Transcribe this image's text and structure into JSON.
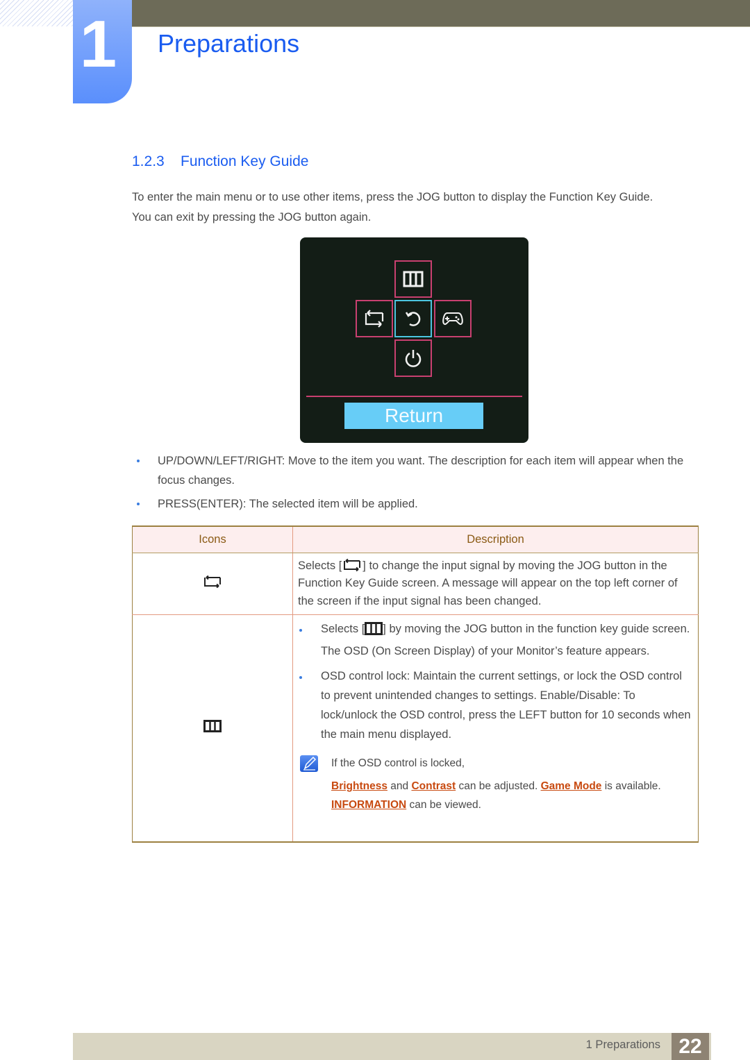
{
  "chapter": {
    "number": "1",
    "title": "Preparations"
  },
  "section": {
    "number": "1.2.3",
    "title": "Function Key Guide"
  },
  "intro": {
    "line1": "To enter the main menu or to use other items, press the JOG button to display the Function Key Guide.",
    "line2": "You can exit by pressing the JOG button again."
  },
  "osd": {
    "buttons": {
      "up": "menu-icon",
      "left": "input-source-icon",
      "center": "return-icon",
      "right": "game-controller-icon",
      "down": "power-icon"
    },
    "label": "Return",
    "colors": {
      "background": "#131d16",
      "border": "#c94070",
      "focus": "#4cc6e0",
      "label_bg": "#67cdf7"
    }
  },
  "bullets": [
    "UP/DOWN/LEFT/RIGHT: Move to the item you want. The description for each item will appear when the focus changes.",
    "PRESS(ENTER): The selected item will be applied."
  ],
  "table": {
    "headers": [
      "Icons",
      "Description"
    ],
    "rows": [
      {
        "icon": "input-source-icon",
        "desc_prefix": "Selects [",
        "desc_suffix": "] to change the input signal by moving the JOG button in the Function Key Guide screen. A message will appear on the top left corner of the screen if the input signal has been changed."
      },
      {
        "icon": "menu-icon",
        "bullet1_prefix": "Selects [",
        "bullet1_suffix": "] by moving the JOG button in the function key guide screen.",
        "para": "The OSD (On Screen Display) of your Monitor’s feature appears.",
        "bullet2": "OSD control lock: Maintain the current settings, or lock the OSD control to prevent unintended changes to settings. Enable/Disable: To lock/unlock the OSD control, press the LEFT button for 10 seconds when the main menu displayed.",
        "note": {
          "line1": "If the OSD control is locked,",
          "link_brightness": "Brightness",
          "text_and": " and ",
          "link_contrast": "Contrast",
          "text_adjusted": " can be adjusted. ",
          "link_game_mode": "Game Mode",
          "text_available": " is available.",
          "link_information": "INFORMATION",
          "text_viewed": " can be viewed."
        }
      }
    ]
  },
  "footer": {
    "label": "1 Preparations",
    "page": "22"
  }
}
